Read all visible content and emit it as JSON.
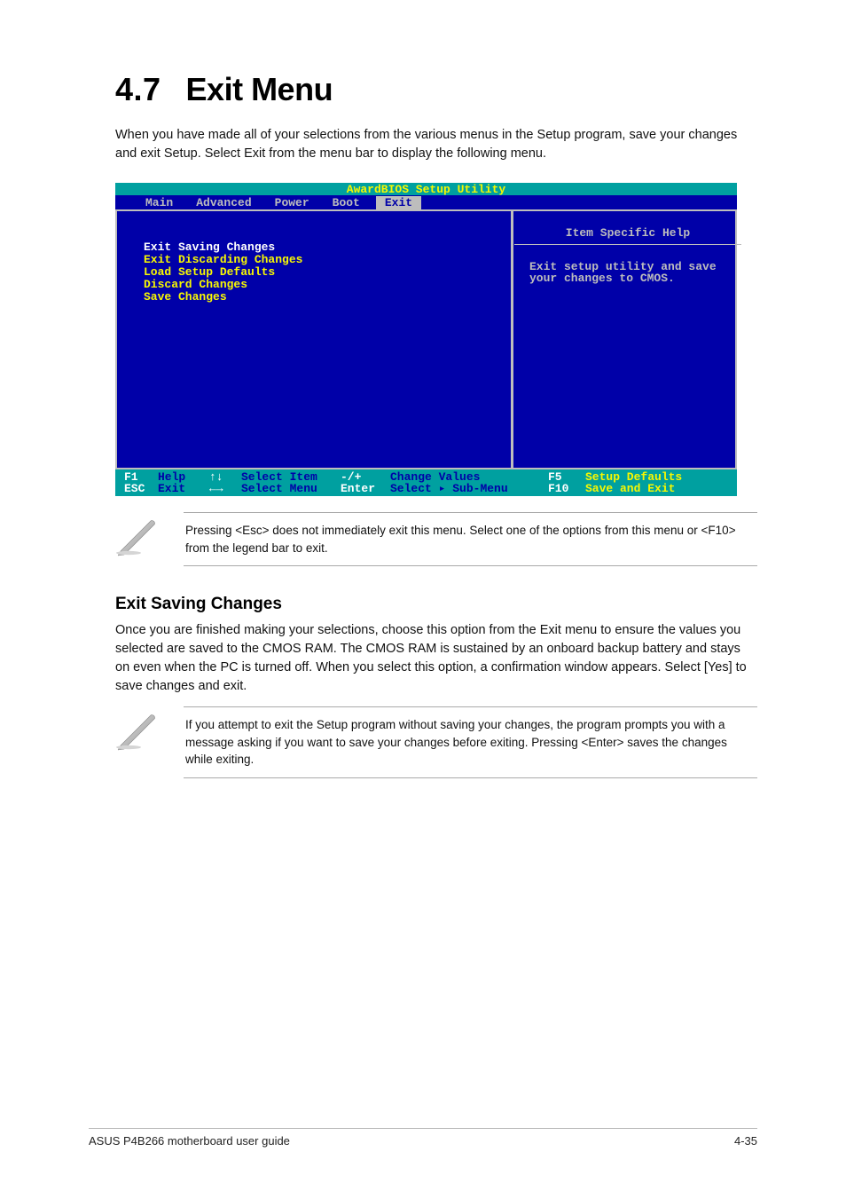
{
  "heading": {
    "num": "4.7",
    "title": "Exit Menu"
  },
  "intro": "When you have made all of your selections from the various menus in the Setup program, save your changes and exit Setup. Select Exit from the menu bar to display the following menu.",
  "bios": {
    "title": "AwardBIOS Setup Utility",
    "tabs": [
      "Main",
      "Advanced",
      "Power",
      "Boot",
      "Exit"
    ],
    "active_tab": "Exit",
    "items": [
      "Exit Saving Changes",
      "Exit Discarding Changes",
      "Load Setup Defaults",
      "Discard Changes",
      "Save Changes"
    ],
    "selected_item": "Exit Saving Changes",
    "help_title": "Item Specific Help",
    "help_body": "Exit setup utility and save your changes to CMOS.",
    "footer": {
      "r1": {
        "k1": "F1",
        "l1": "Help",
        "k2": "↑↓",
        "l2": "Select Item",
        "k3": "-/+",
        "l3": "Change Values",
        "k4": "F5",
        "l4": "Setup Defaults"
      },
      "r2": {
        "k1": "ESC",
        "l1": "Exit",
        "k2": "←→",
        "l2": "Select Menu",
        "k3": "Enter",
        "l3": "Select ▸ Sub-Menu",
        "k4": "F10",
        "l4": "Save and Exit"
      }
    }
  },
  "note1": "Pressing <Esc> does not immediately exit this menu. Select one of the options from this menu or <F10> from the legend bar to exit.",
  "sub_heading": "Exit Saving Changes",
  "para1": "Once you are finished making your selections, choose this option from the Exit menu to ensure the values you selected are saved to the CMOS RAM. The CMOS RAM is sustained by an onboard backup battery and stays on even when the PC is turned off. When you select this option, a confirmation window appears. Select [Yes] to save changes and exit.",
  "note2": "If you attempt to exit the Setup program without saving your changes, the program prompts you with a message asking if you want to save your changes before exiting. Pressing <Enter> saves the changes while exiting.",
  "footer": {
    "left": "ASUS P4B266 motherboard user guide",
    "right": "4-35"
  }
}
